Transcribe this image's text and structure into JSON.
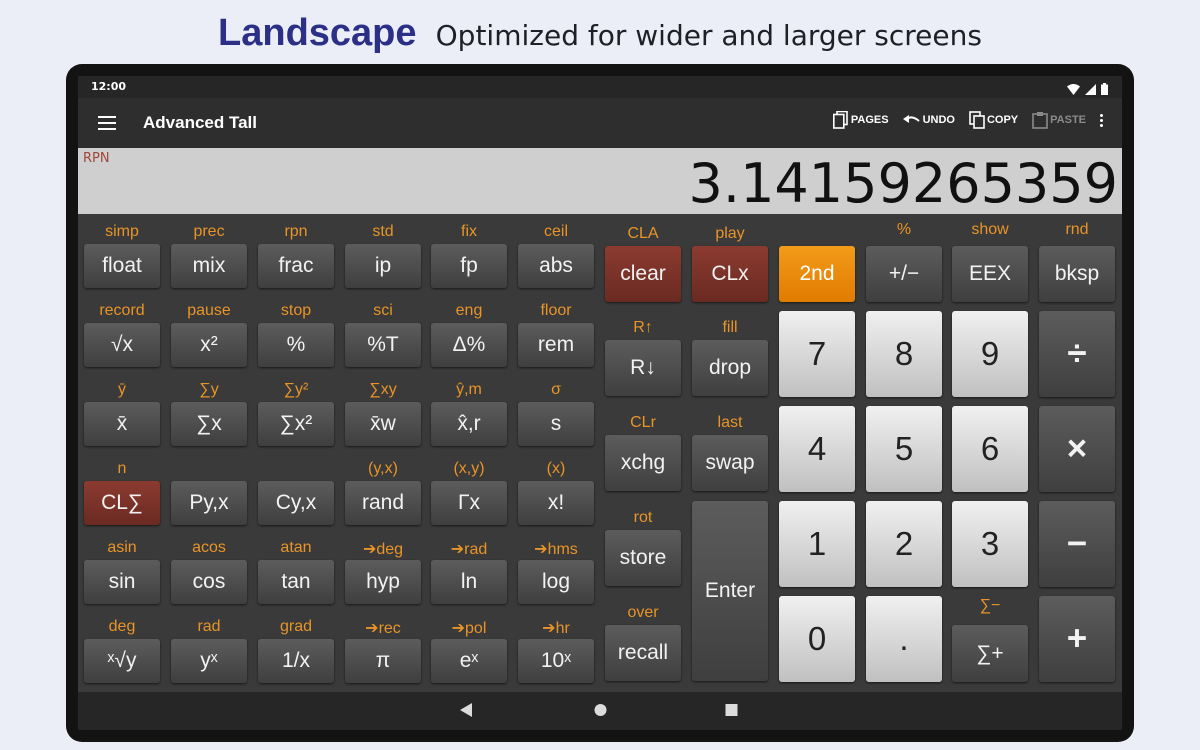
{
  "promo": {
    "title": "Landscape",
    "subtitle": "Optimized for wider and larger screens"
  },
  "status_bar": {
    "time": "12:00",
    "icons": [
      "wifi-icon",
      "signal-icon",
      "battery-icon"
    ]
  },
  "toolbar": {
    "title": "Advanced Tall",
    "actions": [
      {
        "label": "PAGES",
        "icon": "pages-icon",
        "enabled": true
      },
      {
        "label": "UNDO",
        "icon": "undo-icon",
        "enabled": true
      },
      {
        "label": "COPY",
        "icon": "copy-icon",
        "enabled": true
      },
      {
        "label": "PASTE",
        "icon": "paste-icon",
        "enabled": false
      }
    ]
  },
  "display": {
    "mode": "RPN",
    "value": "3.14159265359"
  },
  "sci_grid": [
    [
      {
        "shift": "simp",
        "key": "float"
      },
      {
        "shift": "prec",
        "key": "mix"
      },
      {
        "shift": "rpn",
        "key": "frac"
      },
      {
        "shift": "std",
        "key": "ip"
      },
      {
        "shift": "fix",
        "key": "fp"
      },
      {
        "shift": "ceil",
        "key": "abs"
      }
    ],
    [
      {
        "shift": "record",
        "key": "√x"
      },
      {
        "shift": "pause",
        "key": "x²"
      },
      {
        "shift": "stop",
        "key": "%"
      },
      {
        "shift": "sci",
        "key": "%T"
      },
      {
        "shift": "eng",
        "key": "Δ%"
      },
      {
        "shift": "floor",
        "key": "rem"
      }
    ],
    [
      {
        "shift": "ȳ",
        "key": "x̄"
      },
      {
        "shift": "∑y",
        "key": "∑x"
      },
      {
        "shift": "∑y²",
        "key": "∑x²"
      },
      {
        "shift": "∑xy",
        "key": "x̄w"
      },
      {
        "shift": "ŷ,m",
        "key": "x̂,r"
      },
      {
        "shift": "σ",
        "key": "s"
      }
    ],
    [
      {
        "shift": "n",
        "key": "CL∑"
      },
      {
        "shift": "",
        "key": "Py,x"
      },
      {
        "shift": "",
        "key": "Cy,x"
      },
      {
        "shift": "(y,x)",
        "key": "rand"
      },
      {
        "shift": "(x,y)",
        "key": "Γx"
      },
      {
        "shift": "(x)",
        "key": "x!"
      }
    ],
    [
      {
        "shift": "asin",
        "key": "sin"
      },
      {
        "shift": "acos",
        "key": "cos"
      },
      {
        "shift": "atan",
        "key": "tan"
      },
      {
        "shift": "➔deg",
        "key": "hyp"
      },
      {
        "shift": "➔rad",
        "key": "ln"
      },
      {
        "shift": "➔hms",
        "key": "log"
      }
    ],
    [
      {
        "shift": "deg",
        "key": "ˣ√y"
      },
      {
        "shift": "rad",
        "key": "yˣ"
      },
      {
        "shift": "grad",
        "key": "1/x"
      },
      {
        "shift": "➔rec",
        "key": "π"
      },
      {
        "shift": "➔pol",
        "key": "eˣ"
      },
      {
        "shift": "➔hr",
        "key": "10ˣ"
      }
    ]
  ],
  "stack_keys": {
    "cla": "CLA",
    "clear": "clear",
    "play": "play",
    "clx": "CLx",
    "r_up": "R↑",
    "r_down": "R↓",
    "fill": "fill",
    "drop": "drop",
    "clr": "CLr",
    "xchg": "xchg",
    "last": "last",
    "swap": "swap",
    "rot": "rot",
    "store": "store",
    "enter": "Enter",
    "over": "over",
    "recall": "recall"
  },
  "main_keys": {
    "second": "2nd",
    "percent": "%",
    "plus_minus": "+/−",
    "show": "show",
    "eex": "EEX",
    "rnd": "rnd",
    "bksp": "bksp",
    "divide": "÷",
    "multiply": "×",
    "minus": "−",
    "plus": "+",
    "sigma_minus": "∑−",
    "sigma_plus": "∑+",
    "digits": [
      "7",
      "8",
      "9",
      "4",
      "5",
      "6",
      "1",
      "2",
      "3",
      "0",
      "."
    ]
  },
  "nav": {
    "icons": [
      "back-icon",
      "home-icon",
      "recents-icon"
    ]
  },
  "colors": {
    "accent": "#e89427",
    "second_key": "#f08c00",
    "clear_key": "#7a3228",
    "promo_title": "#2b2f86"
  }
}
